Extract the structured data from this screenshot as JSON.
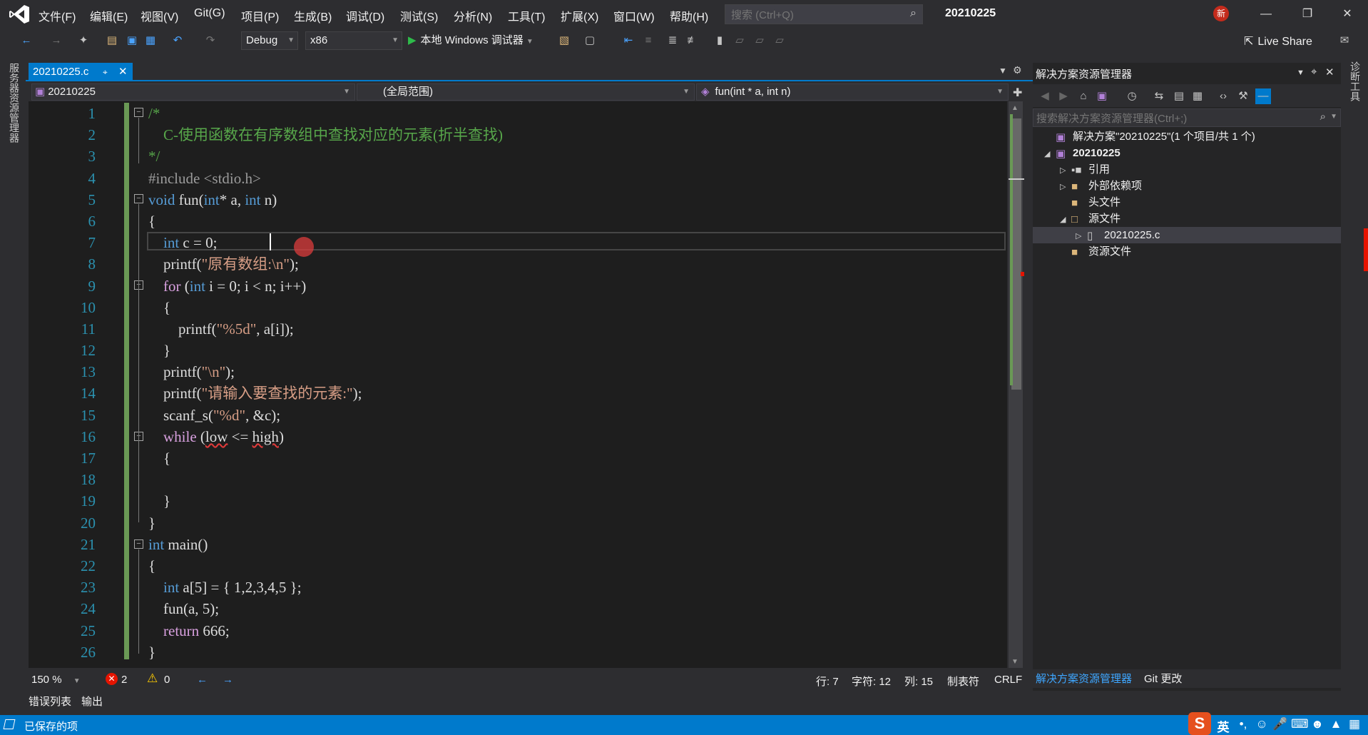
{
  "menu": [
    "文件(F)",
    "编辑(E)",
    "视图(V)",
    "Git(G)",
    "项目(P)",
    "生成(B)",
    "调试(D)",
    "测试(S)",
    "分析(N)",
    "工具(T)",
    "扩展(X)",
    "窗口(W)",
    "帮助(H)"
  ],
  "search": {
    "placeholder": "搜索 (Ctrl+Q)"
  },
  "project_name": "20210225",
  "new_badge": "新",
  "toolbar": {
    "config": "Debug",
    "platform": "x86",
    "run_label": "本地 Windows 调试器",
    "live_share": "Live Share"
  },
  "left_strip": "服务器资源管理器",
  "right_strip": "诊断工具",
  "editor": {
    "tab_name": "20210225.c",
    "nav_project": "20210225",
    "nav_scope": "(全局范围)",
    "nav_function": "fun(int * a, int n)",
    "line_numbers": [
      "1",
      "2",
      "3",
      "4",
      "5",
      "6",
      "7",
      "8",
      "9",
      "10",
      "11",
      "12",
      "13",
      "14",
      "15",
      "16",
      "17",
      "18",
      "19",
      "20",
      "21",
      "22",
      "23",
      "24",
      "25",
      "26"
    ],
    "code": {
      "l1": "/*",
      "l2": "    C-使用函数在有序数组中查找对应的元素(折半查找)",
      "l3": "*/",
      "l4": "#include <stdio.h>",
      "l5_kw1": "void",
      "l5_fn": " fun(",
      "l5_kw2": "int",
      "l5_mid": "* a, ",
      "l5_kw3": "int",
      "l5_end": " n)",
      "l6": "{",
      "l7_kw": "    int",
      "l7_rest": " c = 0;",
      "l8_fn": "    printf(",
      "l8_str": "\"原有数组:\\n\"",
      "l8_end": ");",
      "l9_kw": "    for",
      "l9_a": " (",
      "l9_kw2": "int",
      "l9_rest": " i = 0; i < n; i++)",
      "l10": "    {",
      "l11_fn": "        printf(",
      "l11_str": "\"%5d\"",
      "l11_end": ", a[i]);",
      "l12": "    }",
      "l13_fn": "    printf(",
      "l13_str": "\"\\n\"",
      "l13_end": ");",
      "l14_fn": "    printf(",
      "l14_str": "\"请输入要查找的元素:\"",
      "l14_end": ");",
      "l15_fn": "    scanf_s(",
      "l15_str": "\"%d\"",
      "l15_end": ", &c);",
      "l16_kw": "    while",
      "l16_a": " (",
      "l16_low": "low",
      "l16_op": " <= ",
      "l16_high": "high",
      "l16_end": ")",
      "l17": "    {",
      "l18": "",
      "l19": "    }",
      "l20": "}",
      "l21_kw": "int",
      "l21_rest": " main()",
      "l22": "{",
      "l23_kw": "    int",
      "l23_rest": " a[5] = { 1,2,3,4,5 };",
      "l24": "    fun(a, 5);",
      "l25_kw": "    return",
      "l25_rest": " 666;",
      "l26": "}"
    },
    "status": {
      "zoom": "150 %",
      "errors": "2",
      "warnings": "0",
      "line": "行: 7",
      "char": "字符: 12",
      "col": "列: 15",
      "indent": "制表符",
      "eol": "CRLF"
    }
  },
  "bottom_tabs": [
    "错误列表",
    "输出"
  ],
  "solution_explorer": {
    "title": "解决方案资源管理器",
    "search_placeholder": "搜索解决方案资源管理器(Ctrl+;)",
    "items": [
      {
        "label": "解决方案\"20210225\"(1 个项目/共 1 个)"
      },
      {
        "label": "20210225"
      },
      {
        "label": "引用"
      },
      {
        "label": "外部依赖项"
      },
      {
        "label": "头文件"
      },
      {
        "label": "源文件"
      },
      {
        "label": "20210225.c"
      },
      {
        "label": "资源文件"
      }
    ],
    "bottom_tabs": [
      "解决方案资源管理器",
      "Git 更改"
    ]
  },
  "statusbar": {
    "text": "已保存的项"
  },
  "tray": {
    "ime": "英"
  },
  "colors": {
    "accent": "#007acc",
    "comment": "#57a64a",
    "keyword": "#569cd6",
    "control": "#d8a0df",
    "string": "#d69d85",
    "line_number": "#2b91af"
  }
}
